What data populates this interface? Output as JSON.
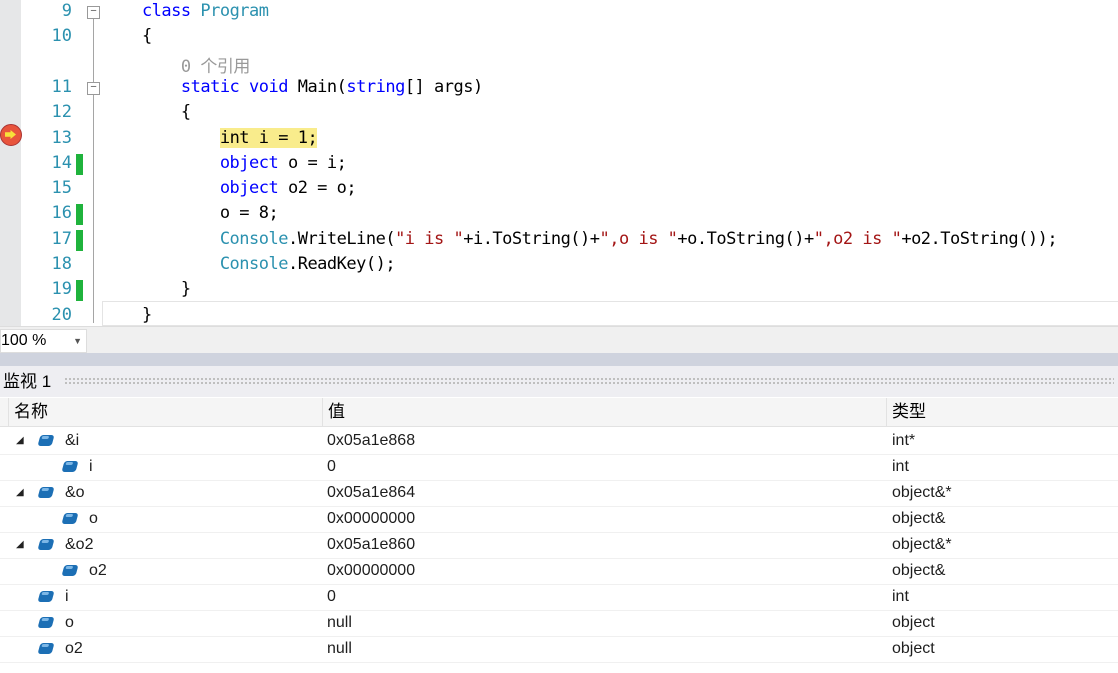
{
  "editor": {
    "lines": [
      {
        "num": "9",
        "fold": "−",
        "tokens": [
          [
            "kw",
            "    class "
          ],
          [
            "ty",
            "Program"
          ]
        ]
      },
      {
        "num": "10",
        "tokens": [
          [
            "",
            "    {"
          ]
        ]
      },
      {
        "num": "",
        "tokens": [
          [
            "cm",
            "        0 个引用"
          ]
        ]
      },
      {
        "num": "11",
        "fold": "−",
        "tokens": [
          [
            "kw",
            "        static void "
          ],
          [
            "",
            "Main("
          ],
          [
            "kw",
            "string"
          ],
          [
            "",
            "[] args)"
          ]
        ]
      },
      {
        "num": "12",
        "tokens": [
          [
            "",
            "        {"
          ]
        ]
      },
      {
        "num": "13",
        "tokens": [
          [
            "",
            "            "
          ],
          [
            "hl",
            "int i = 1;"
          ]
        ]
      },
      {
        "num": "14",
        "changed": true,
        "tokens": [
          [
            "kw",
            "            object "
          ],
          [
            "",
            "o = i;"
          ]
        ]
      },
      {
        "num": "15",
        "tokens": [
          [
            "kw",
            "            object "
          ],
          [
            "",
            "o2 = o;"
          ]
        ]
      },
      {
        "num": "16",
        "changed": true,
        "tokens": [
          [
            "",
            "            o = 8;"
          ]
        ]
      },
      {
        "num": "17",
        "changed": true,
        "tokens": [
          [
            "ty",
            "            Console"
          ],
          [
            "",
            ".WriteLine("
          ],
          [
            "st",
            "\"i is \""
          ],
          [
            "",
            "+i.ToString()+"
          ],
          [
            "st",
            "\",o is \""
          ],
          [
            "",
            "+o.ToString()+"
          ],
          [
            "st",
            "\",o2 is \""
          ],
          [
            "",
            "+o2.ToString());"
          ]
        ]
      },
      {
        "num": "18",
        "tokens": [
          [
            "ty",
            "            Console"
          ],
          [
            "",
            ".ReadKey();"
          ]
        ]
      },
      {
        "num": "19",
        "changed": true,
        "tokens": [
          [
            "",
            "        }"
          ]
        ]
      },
      {
        "num": "20",
        "tokens": [
          [
            "",
            "    }"
          ]
        ]
      }
    ],
    "zoom": "100 %"
  },
  "watch": {
    "title": "监视 1",
    "headers": {
      "name": "名称",
      "value": "值",
      "type": "类型"
    },
    "rows": [
      {
        "name": "&i",
        "value": "0x05a1e868",
        "type": "int*",
        "level": 0,
        "expanded": true
      },
      {
        "name": "i",
        "value": "0",
        "type": "int",
        "level": 1
      },
      {
        "name": "&o",
        "value": "0x05a1e864",
        "type": "object&*",
        "level": 0,
        "expanded": true
      },
      {
        "name": "o",
        "value": "0x00000000",
        "type": "object&",
        "level": 1
      },
      {
        "name": "&o2",
        "value": "0x05a1e860",
        "type": "object&*",
        "level": 0,
        "expanded": true
      },
      {
        "name": "o2",
        "value": "0x00000000",
        "type": "object&",
        "level": 1
      },
      {
        "name": "i",
        "value": "0",
        "type": "int",
        "level": 0
      },
      {
        "name": "o",
        "value": "null",
        "type": "object",
        "level": 0
      },
      {
        "name": "o2",
        "value": "null",
        "type": "object",
        "level": 0
      }
    ]
  }
}
